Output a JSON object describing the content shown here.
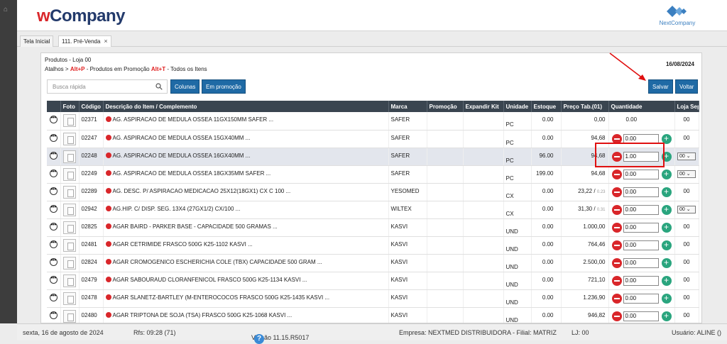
{
  "app": {
    "logo_w": "w",
    "logo_rest": "Company",
    "brand_right": "NextCompany"
  },
  "tabs": [
    {
      "label": "Tela Inicial"
    },
    {
      "label": "111. Pré-Venda",
      "close": "×"
    }
  ],
  "panel": {
    "title": "Produtos - Loja 00",
    "shortcut_prefix": "Atalhos > ",
    "shortcut_key1": "Alt+P",
    "shortcut_text1": " - Produtos em Promoção ",
    "shortcut_key2": "Alt+T",
    "shortcut_text2": " - Todos os Itens",
    "date": "16/08/2024"
  },
  "toolbar": {
    "search_placeholder": "Busca rápida",
    "colunas": "Colunas",
    "em_promocao": "Em promoção",
    "salvar": "Salvar",
    "voltar": "Voltar"
  },
  "columns": [
    "",
    "Foto",
    "Código",
    "Descrição do Item / Complemento",
    "Marca",
    "Promoção",
    "Expandir Kit",
    "Unidade",
    "Estoque",
    "Preço Tab.(01)",
    "Quantidade",
    "Loja Sep."
  ],
  "rows": [
    {
      "code": "02371",
      "desc": "AG. ASPIRACAO DE MEDULA OSSEA 11GX150MM SAFER ...",
      "marca": "SAFER",
      "unidade": "PC",
      "estoque": "0.00",
      "preco": "0,00",
      "preco_extra": "",
      "qty": "0.00",
      "loja": "00",
      "loja_select": false,
      "qty_style": "text"
    },
    {
      "code": "02247",
      "desc": "AG. ASPIRACAO DE MEDULA OSSEA 15GX40MM ...",
      "marca": "SAFER",
      "unidade": "PC",
      "estoque": "0.00",
      "preco": "94,68",
      "preco_extra": "",
      "qty": "0.00",
      "loja": "00",
      "loja_select": false,
      "qty_style": "input"
    },
    {
      "code": "02248",
      "desc": "AG. ASPIRACAO DE MEDULA OSSEA 16GX40MM ...",
      "marca": "SAFER",
      "unidade": "PC",
      "estoque": "96.00",
      "preco": "94,68",
      "preco_extra": "",
      "qty": "1.00",
      "loja": "00",
      "loja_select": true,
      "qty_style": "input"
    },
    {
      "code": "02249",
      "desc": "AG. ASPIRACAO DE MEDULA OSSEA 18GX35MM SAFER ...",
      "marca": "SAFER",
      "unidade": "PC",
      "estoque": "199.00",
      "preco": "94,68",
      "preco_extra": "",
      "qty": "0.00",
      "loja": "00",
      "loja_select": true,
      "qty_style": "input"
    },
    {
      "code": "02289",
      "desc": "AG. DESC. P/ ASPIRACAO MEDICACAO 25X12(18GX1) CX C 100 ...",
      "marca": "YESOMED",
      "unidade": "CX",
      "estoque": "0.00",
      "preco": "23,22",
      "preco_extra": "0.23",
      "qty": "0.00",
      "loja": "00",
      "loja_select": false,
      "qty_style": "input"
    },
    {
      "code": "02942",
      "desc": "AG.HIP. C/ DISP. SEG. 13X4 (27GX1/2) CX/100 ...",
      "marca": "WILTEX",
      "unidade": "CX",
      "estoque": "0.00",
      "preco": "31,30",
      "preco_extra": "0.31",
      "qty": "0.00",
      "loja": "00",
      "loja_select": true,
      "qty_style": "input"
    },
    {
      "code": "02825",
      "desc": "AGAR BAIRD - PARKER BASE - CAPACIDADE 500 GRAMAS ...",
      "marca": "KASVI",
      "unidade": "UND",
      "estoque": "0.00",
      "preco": "1.000,00",
      "preco_extra": "",
      "qty": "0.00",
      "loja": "00",
      "loja_select": false,
      "qty_style": "input"
    },
    {
      "code": "02481",
      "desc": "AGAR CETRIMIDE FRASCO 500G K25-1102 KASVI ...",
      "marca": "KASVI",
      "unidade": "UND",
      "estoque": "0.00",
      "preco": "764,46",
      "preco_extra": "",
      "qty": "0.00",
      "loja": "00",
      "loja_select": false,
      "qty_style": "input"
    },
    {
      "code": "02824",
      "desc": "AGAR CROMOGENICO ESCHERICHIA COLE (TBX) CAPACIDADE 500 GRAM ...",
      "marca": "KASVI",
      "unidade": "UND",
      "estoque": "0.00",
      "preco": "2.500,00",
      "preco_extra": "",
      "qty": "0.00",
      "loja": "00",
      "loja_select": false,
      "qty_style": "input"
    },
    {
      "code": "02479",
      "desc": "AGAR SABOURAUD CLORANFENICOL FRASCO 500G K25-1134 KASVI ...",
      "marca": "KASVI",
      "unidade": "UND",
      "estoque": "0.00",
      "preco": "721,10",
      "preco_extra": "",
      "qty": "0.00",
      "loja": "00",
      "loja_select": false,
      "qty_style": "input"
    },
    {
      "code": "02478",
      "desc": "AGAR SLANETZ-BARTLEY (M-ENTEROCOCOS FRASCO 500G K25-1435 KASVI ...",
      "marca": "KASVI",
      "unidade": "UND",
      "estoque": "0.00",
      "preco": "1.236,90",
      "preco_extra": "",
      "qty": "0.00",
      "loja": "00",
      "loja_select": false,
      "qty_style": "input"
    },
    {
      "code": "02480",
      "desc": "AGAR TRIPTONA DE SOJA (TSA) FRASCO 500G K25-1068 KASVI ...",
      "marca": "KASVI",
      "unidade": "UND",
      "estoque": "0.00",
      "preco": "946,82",
      "preco_extra": "",
      "qty": "0.00",
      "loja": "00",
      "loja_select": false,
      "qty_style": "input"
    }
  ],
  "status": {
    "date": "sexta, 16 de agosto de 2024",
    "rfs": "Rfs: 09:28 (71)",
    "version": "Versão 11.15.R5017",
    "help": "?",
    "empresa": "Empresa: NEXTMED DISTRIBUIDORA - Filial: MATRIZ",
    "lj": "LJ: 00",
    "usuario": "Usuário: ALINE ()"
  },
  "colors": {
    "accent": "#1f6aa5",
    "danger": "#d9262a",
    "success": "#2aa57e",
    "header_dark": "#3a4550"
  }
}
